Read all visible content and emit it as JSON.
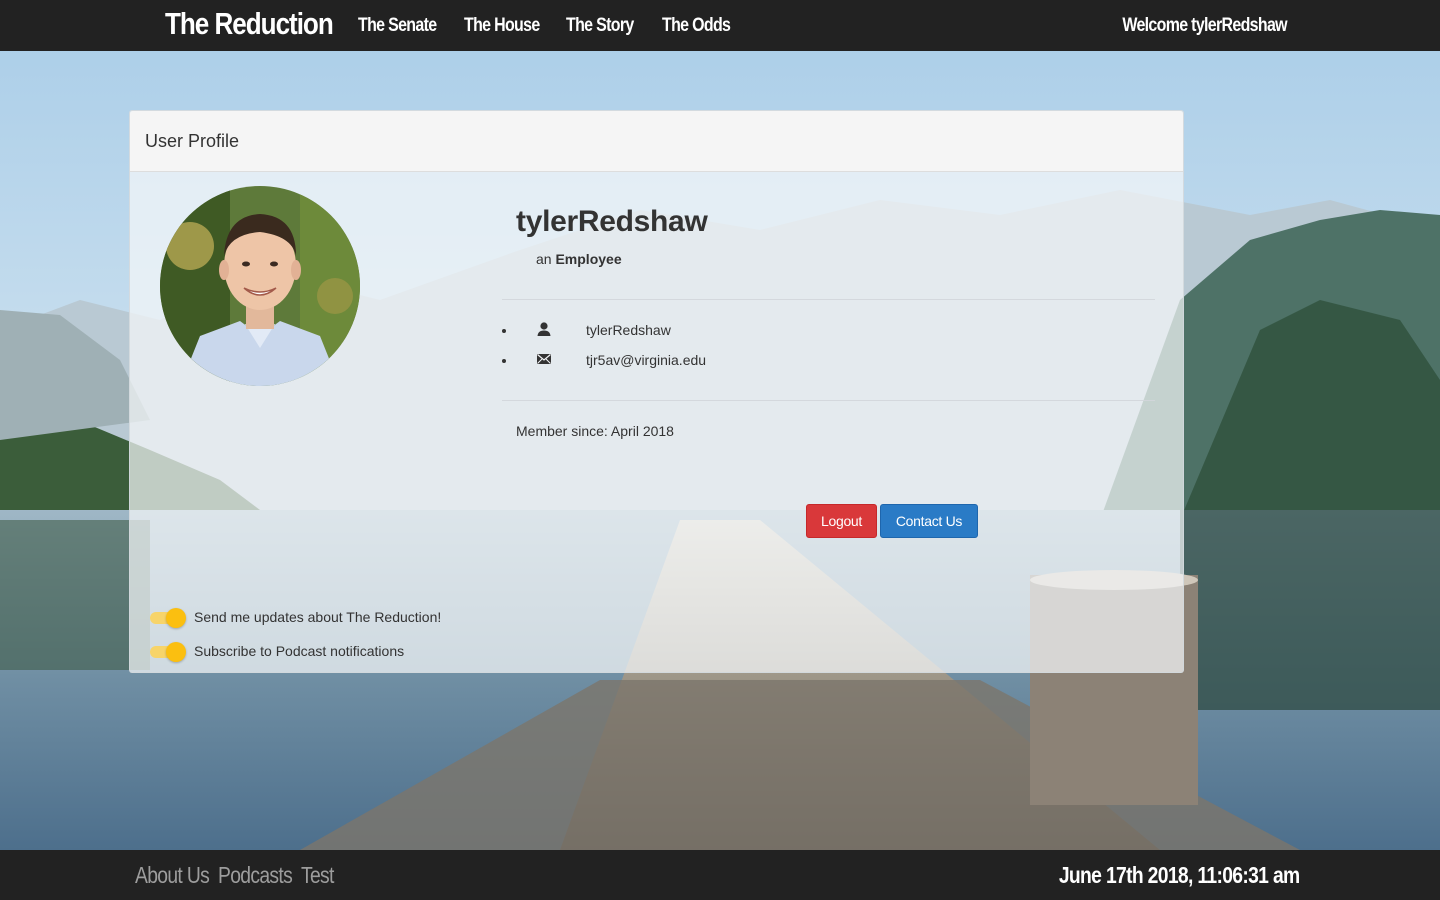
{
  "navbar": {
    "brand": "The Reduction",
    "links": [
      "The Senate",
      "The House",
      "The Story",
      "The Odds"
    ],
    "welcome": "Welcome tylerRedshaw"
  },
  "panel": {
    "title": "User Profile",
    "username": "tylerRedshaw",
    "role_prefix": "an",
    "role": "Employee",
    "details": [
      {
        "icon": "user-icon",
        "value": "tylerRedshaw"
      },
      {
        "icon": "envelope-icon",
        "value": "tjr5av@virginia.edu"
      }
    ],
    "member_since": "Member since: April 2018",
    "logout_label": "Logout",
    "contact_label": "Contact Us",
    "toggles": [
      {
        "label": "Send me updates about The Reduction!",
        "on": true
      },
      {
        "label": "Subscribe to Podcast notifications",
        "on": true
      }
    ]
  },
  "footer": {
    "links": [
      "About Us",
      "Podcasts",
      "Test"
    ],
    "clock": "June 17th 2018, 11:06:31 am"
  },
  "colors": {
    "navbar_bg": "#222222",
    "logout": "#d9383a",
    "contact": "#2a7bc6",
    "toggle_on": "#fbbf10"
  }
}
